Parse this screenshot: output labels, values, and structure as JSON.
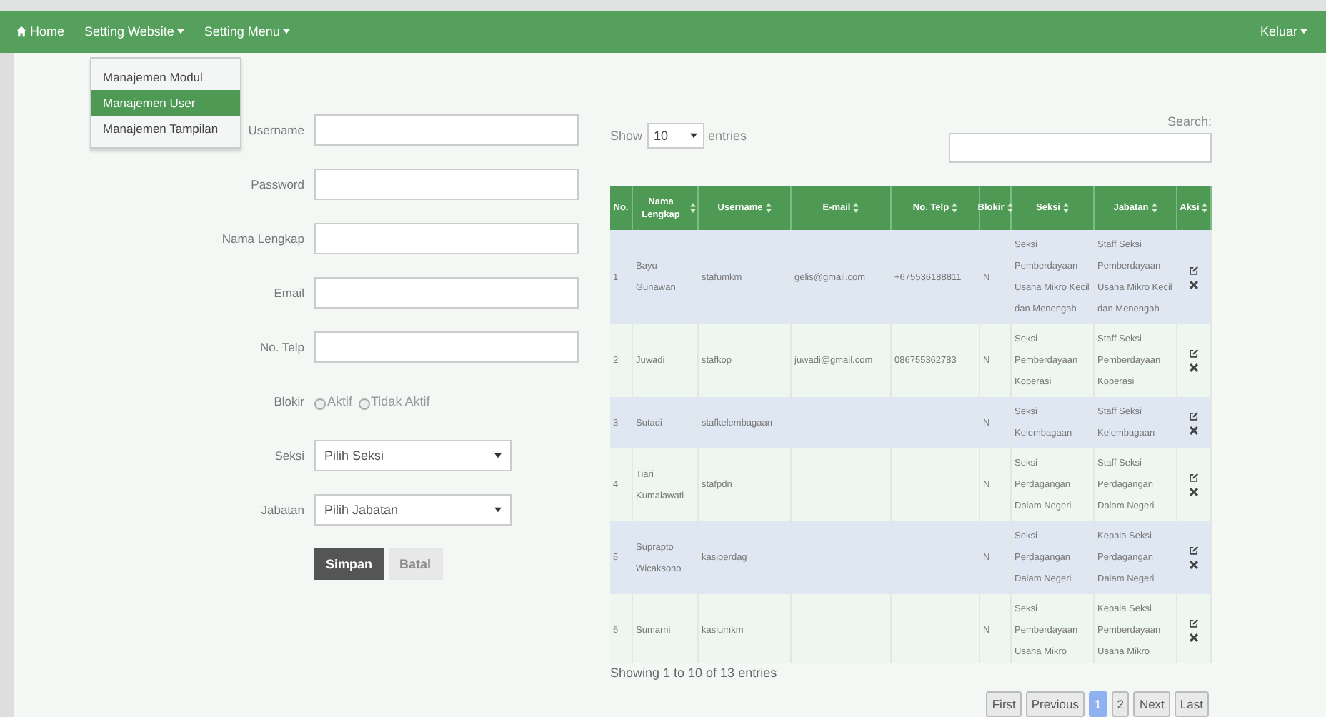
{
  "navbar": {
    "items": [
      {
        "label": "Home",
        "kind": "home"
      },
      {
        "label": "Setting Website",
        "kind": "dropdown"
      },
      {
        "label": "Setting Menu",
        "kind": "dropdown"
      }
    ],
    "right_item": {
      "label": "Keluar"
    }
  },
  "dropdown_menu": {
    "items": [
      {
        "label": "Manajemen Modul",
        "selected": false
      },
      {
        "label": "Manajemen User",
        "selected": true
      },
      {
        "label": "Manajemen Tampilan",
        "selected": false
      }
    ]
  },
  "form": {
    "fields": [
      {
        "label": "Username",
        "kind": "text"
      },
      {
        "label": "Password",
        "kind": "text"
      },
      {
        "label": "Nama Lengkap",
        "kind": "text"
      },
      {
        "label": "Email",
        "kind": "text"
      },
      {
        "label": "No. Telp",
        "kind": "text"
      },
      {
        "label": "Blokir",
        "kind": "radio",
        "options": [
          {
            "label": "Aktif",
            "selected": false
          },
          {
            "label": "Tidak Aktif",
            "selected": false
          }
        ]
      },
      {
        "label": "Seksi",
        "kind": "select",
        "value": "Pilih Seksi"
      },
      {
        "label": "Jabatan",
        "kind": "select",
        "value": "Pilih Jabatan"
      }
    ],
    "buttons": [
      {
        "label": "Simpan",
        "disabled": false
      },
      {
        "label": "Batal",
        "disabled": true
      }
    ]
  },
  "table_controls": {
    "show_label": "Show",
    "page_size": "10",
    "entries_label": "entries",
    "search_label": "Search:"
  },
  "table": {
    "columns": [
      "No.",
      "Nama Lengkap",
      "Username",
      "E-mail",
      "No. Telp",
      "Blokir",
      "Seksi",
      "Jabatan",
      "Aksi"
    ],
    "rows": [
      {
        "cells": [
          "1",
          "Bayu Gunawan",
          "stafumkm",
          "gelis@gmail.com",
          "+675536188811",
          "N",
          "Seksi Pemberdayaan Usaha Mikro Kecil dan Menengah",
          "Staff Seksi Pemberdayaan Usaha Mikro Kecil dan Menengah"
        ]
      },
      {
        "cells": [
          "2",
          "Juwadi",
          "stafkop",
          "juwadi@gmail.com",
          "086755362783",
          "N",
          "Seksi Pemberdayaan Koperasi",
          "Staff Seksi Pemberdayaan Koperasi"
        ]
      },
      {
        "cells": [
          "3",
          "Sutadi",
          "stafkelembagaan",
          "",
          "",
          "N",
          "Seksi Kelembagaan",
          "Staff Seksi Kelembagaan"
        ]
      },
      {
        "cells": [
          "4",
          "Tiari Kumalawati",
          "stafpdn",
          "",
          "",
          "N",
          "Seksi Perdagangan Dalam Negeri",
          "Staff Seksi Perdagangan Dalam Negeri"
        ]
      },
      {
        "cells": [
          "5",
          "Suprapto Wicaksono",
          "kasiperdag",
          "",
          "",
          "N",
          "Seksi Perdagangan Dalam Negeri",
          "Kepala Seksi Perdagangan Dalam Negeri"
        ]
      },
      {
        "cells": [
          "6",
          "Sumarni",
          "kasiumkm",
          "",
          "",
          "N",
          "Seksi Pemberdayaan Usaha Mikro",
          "Kepala Seksi Pemberdayaan Usaha Mikro"
        ]
      }
    ]
  },
  "info": "Showing 1 to 10 of 13 entries",
  "pagination": [
    {
      "label": "First",
      "selected": false
    },
    {
      "label": "Previous",
      "selected": false
    },
    {
      "label": "1",
      "selected": true
    },
    {
      "label": "2",
      "selected": false
    },
    {
      "label": "Next",
      "selected": false
    },
    {
      "label": "Last",
      "selected": false
    }
  ]
}
